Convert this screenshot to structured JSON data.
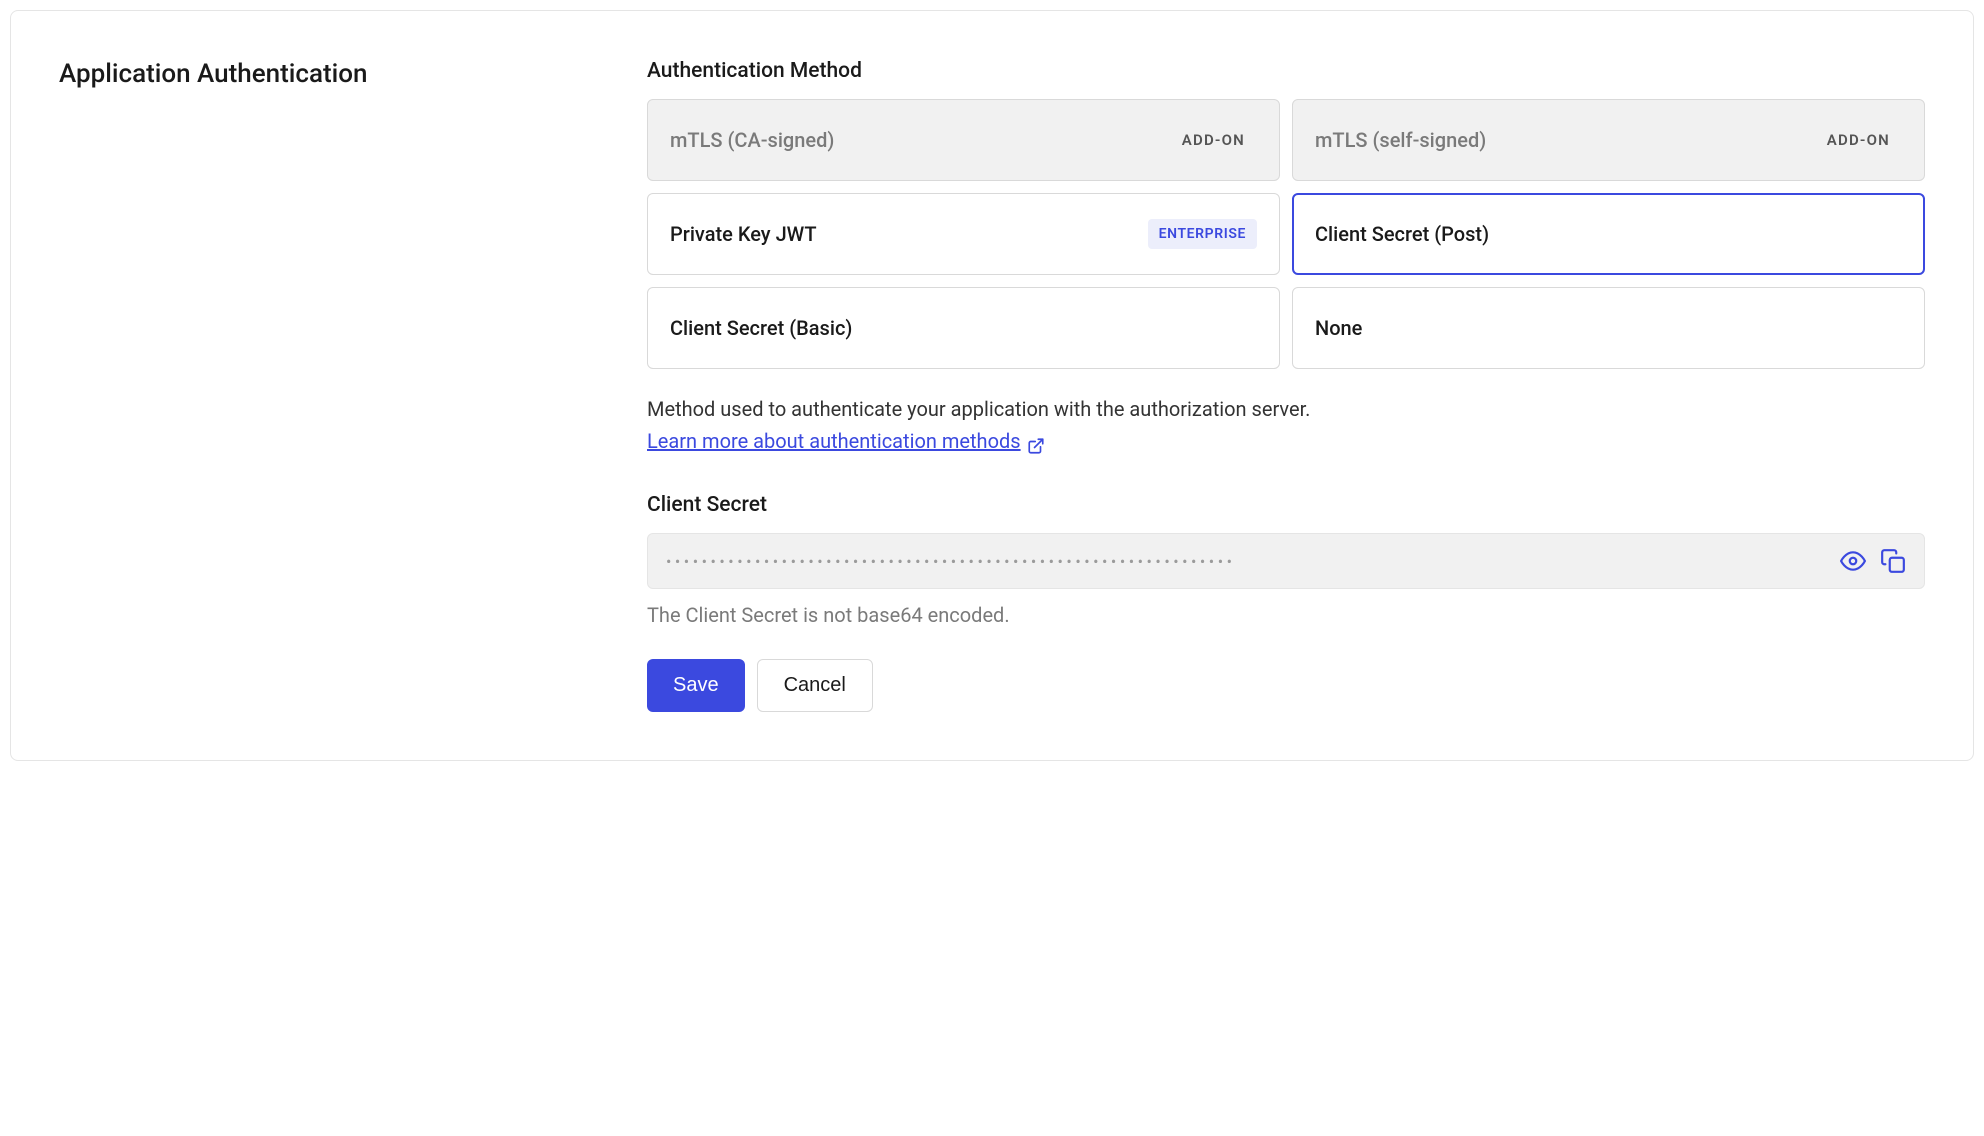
{
  "section": {
    "title": "Application Authentication"
  },
  "authMethod": {
    "label": "Authentication Method",
    "options": [
      {
        "name": "mTLS (CA-signed)",
        "badge": "ADD-ON",
        "disabled": true,
        "selected": false
      },
      {
        "name": "mTLS (self-signed)",
        "badge": "ADD-ON",
        "disabled": true,
        "selected": false
      },
      {
        "name": "Private Key JWT",
        "badge": "ENTERPRISE",
        "disabled": false,
        "selected": false
      },
      {
        "name": "Client Secret (Post)",
        "badge": "",
        "disabled": false,
        "selected": true
      },
      {
        "name": "Client Secret (Basic)",
        "badge": "",
        "disabled": false,
        "selected": false
      },
      {
        "name": "None",
        "badge": "",
        "disabled": false,
        "selected": false
      }
    ],
    "helper": "Method used to authenticate your application with the authorization server.",
    "learnMore": "Learn more about authentication methods"
  },
  "clientSecret": {
    "label": "Client Secret",
    "maskedValue": "••••••••••••••••••••••••••••••••••••••••••••••••••••••••••••••••",
    "hint": "The Client Secret is not base64 encoded."
  },
  "actions": {
    "save": "Save",
    "cancel": "Cancel"
  }
}
